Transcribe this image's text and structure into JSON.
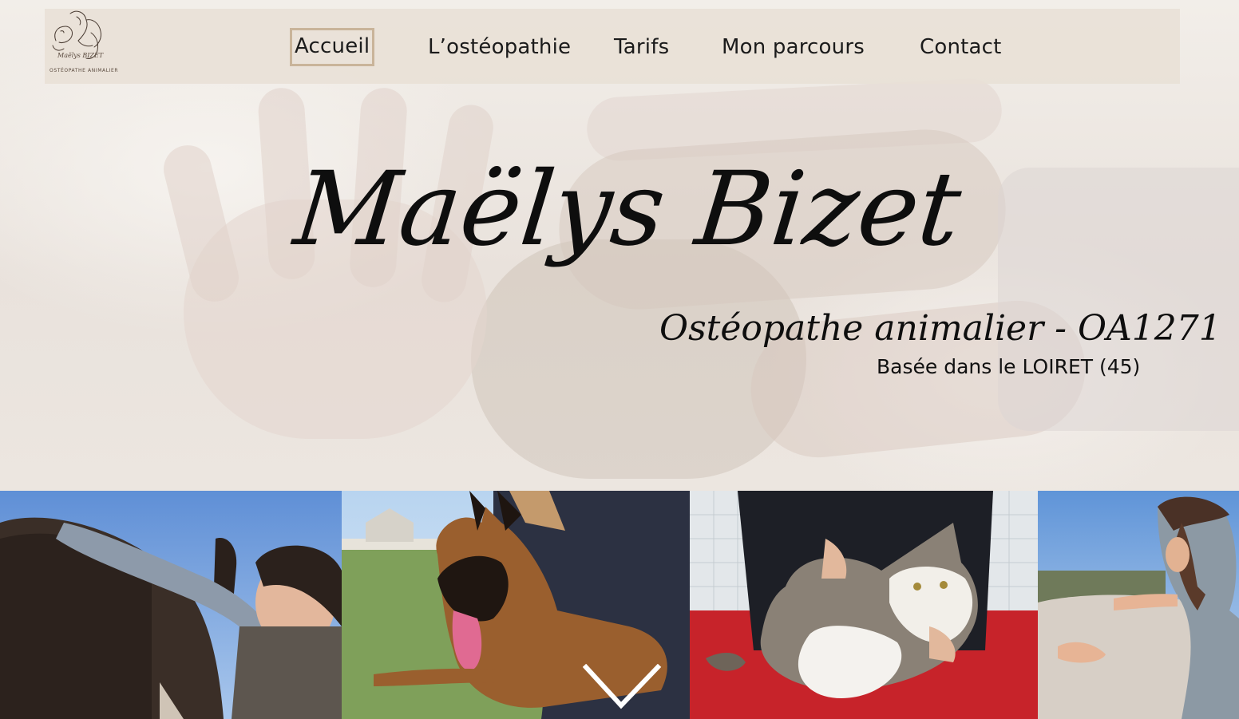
{
  "logo": {
    "name": "Maëlys BIZET",
    "tagline": "OSTÉOPATHE ANIMALIER"
  },
  "nav": {
    "items": [
      {
        "label": "Accueil",
        "active": true
      },
      {
        "label": "L’ostéopathie",
        "active": false
      },
      {
        "label": "Tarifs",
        "active": false
      },
      {
        "label": "Mon parcours",
        "active": false
      },
      {
        "label": "Contact",
        "active": false
      }
    ]
  },
  "hero": {
    "title": "Maëlys Bizet",
    "subtitle": "Ostéopathe animalier - OA1271",
    "location": "Basée dans le LOIRET (45)"
  },
  "gallery": {
    "images": [
      {
        "icon": "horse-photo"
      },
      {
        "icon": "dog-photo"
      },
      {
        "icon": "cat-photo"
      },
      {
        "icon": "horse-back-photo"
      }
    ]
  },
  "colors": {
    "nav_background": "#e8e0d6",
    "active_border": "#c9b49a",
    "text": "#0e0e0e"
  }
}
